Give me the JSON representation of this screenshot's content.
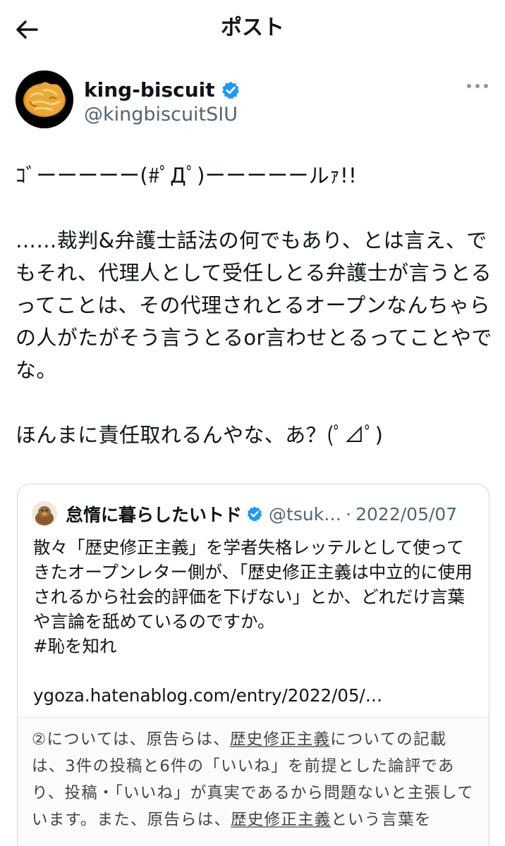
{
  "header": {
    "title": "ポスト"
  },
  "post": {
    "author": {
      "display_name": "king-biscuit",
      "handle": "@kingbiscuitSIU",
      "verified": true
    },
    "text": "ｺﾞーーーーー(#ﾟДﾟ)ーーーーールｧ!!\n\n……裁判&弁護士話法の何でもあり、とは言え、でもそれ、代理人として受任しとる弁護士が言うとるってことは、その代理されとるオープンなんちゃらの人がたがそう言うとるor言わせとるってことやでな。\n\nほんまに責任取れるんやな、あ？(ﾟ⊿ﾟ)"
  },
  "quote": {
    "author": {
      "display_name": "怠惰に暮らしたいトド",
      "handle": "@tsuk…",
      "separator": "·",
      "date": "2022/05/07"
    },
    "text": "散々「歴史修正主義」を学者失格レッテルとして使ってきたオープンレター側が、「歴史修正主義は中立的に使用されるから社会的評価を下げない」とか、どれだけ言葉や言論を舐めているのですか。\n#恥を知れ",
    "link": "ygoza.hatenablog.com/entry/2022/05/…",
    "image_text": {
      "part1": "②については、原告らは、",
      "underline1": "歴史修正主義",
      "part2": "についての記載は、3件の投稿と6件の「いいね」を前提とした論評であり、投稿・「いいね」が真実であるから問題ないと主張しています。また、原告らは、",
      "underline2": "歴史修正主義",
      "part3": "という言葉を"
    }
  },
  "colors": {
    "verified_blue": "#1d9bf0",
    "secondary_text": "#536471"
  }
}
